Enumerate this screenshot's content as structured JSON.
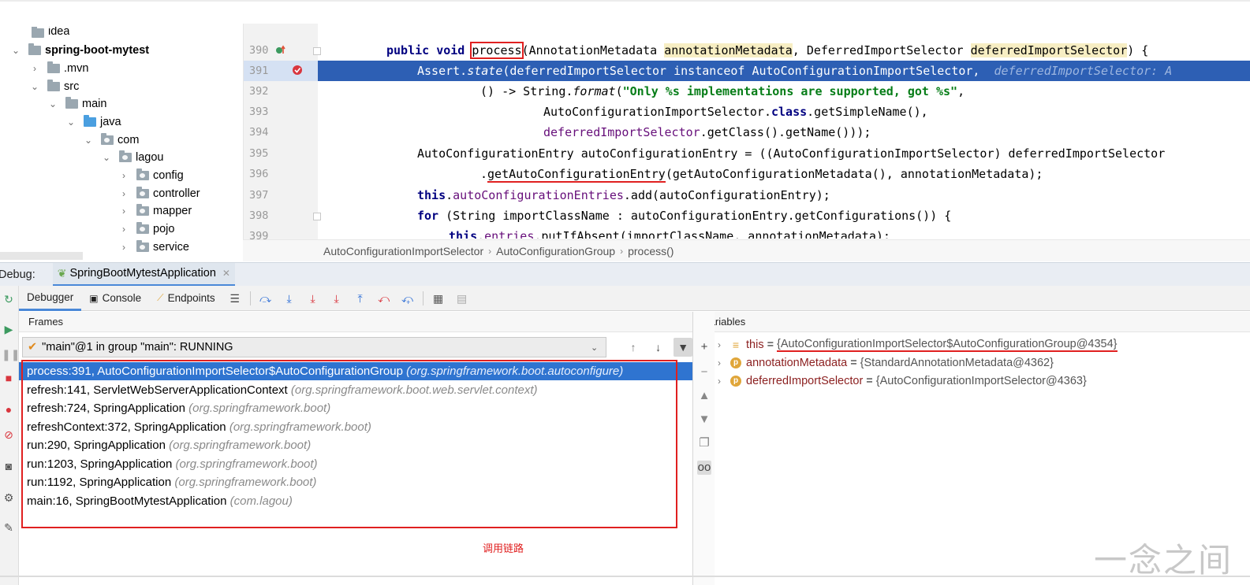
{
  "project_tree": {
    "items": [
      {
        "label": "idea",
        "depth": 1,
        "expanded": null,
        "icon": "folder-icon",
        "bold": false
      },
      {
        "label": "spring-boot-mytest",
        "depth": 0,
        "expanded": true,
        "icon": "module-folder-icon",
        "bold": true
      },
      {
        "label": ".mvn",
        "depth": 1,
        "expanded": false,
        "icon": "folder-icon",
        "bold": false
      },
      {
        "label": "src",
        "depth": 1,
        "expanded": true,
        "icon": "folder-icon",
        "bold": false
      },
      {
        "label": "main",
        "depth": 2,
        "expanded": true,
        "icon": "folder-icon",
        "bold": false
      },
      {
        "label": "java",
        "depth": 3,
        "expanded": true,
        "icon": "source-folder-icon",
        "bold": false
      },
      {
        "label": "com",
        "depth": 4,
        "expanded": true,
        "icon": "package-icon",
        "bold": false
      },
      {
        "label": "lagou",
        "depth": 5,
        "expanded": true,
        "icon": "package-icon",
        "bold": false
      },
      {
        "label": "config",
        "depth": 6,
        "expanded": false,
        "icon": "package-icon",
        "bold": false
      },
      {
        "label": "controller",
        "depth": 6,
        "expanded": false,
        "icon": "package-icon",
        "bold": false
      },
      {
        "label": "mapper",
        "depth": 6,
        "expanded": false,
        "icon": "package-icon",
        "bold": false
      },
      {
        "label": "pojo",
        "depth": 6,
        "expanded": false,
        "icon": "package-icon",
        "bold": false
      },
      {
        "label": "service",
        "depth": 6,
        "expanded": false,
        "icon": "package-icon",
        "bold": false
      }
    ]
  },
  "editor": {
    "line_numbers": [
      "390",
      "391",
      "392",
      "393",
      "394",
      "395",
      "396",
      "397",
      "398",
      "399"
    ],
    "current_line": "391",
    "code": {
      "l390_kw": "public void ",
      "l390_method": "process",
      "l390_a": "(AnnotationMetadata ",
      "l390_p1": "annotationMetadata",
      "l390_b": ", DeferredImportSelector ",
      "l390_p2": "deferredImportSelector",
      "l390_c": ") {",
      "l391_a": "Assert.",
      "l391_state": "state",
      "l391_b": "(deferredImportSelector instanceof AutoConfigurationImportSelector,",
      "l391_hint": "  deferredImportSelector: A",
      "l392_a": "() -> String.",
      "l392_format": "format",
      "l392_b": "(",
      "l392_str": "\"Only %s implementations are supported, got %s\"",
      "l392_c": ",",
      "l393_a": "AutoConfigurationImportSelector.",
      "l393_kw": "class",
      "l393_b": ".getSimpleName(),",
      "l394_fld": "deferredImportSelector",
      "l394_b": ".getClass().getName()));",
      "l395": "AutoConfigurationEntry autoConfigurationEntry = ((AutoConfigurationImportSelector) deferredImportSelector",
      "l396_a": ".",
      "l396_method": "getAutoConfigurationEntry",
      "l396_b": "(getAutoConfigurationMetadata(), annotationMetadata);",
      "l397_kw": "this",
      "l397_dot": ".",
      "l397_fld": "autoConfigurationEntries",
      "l397_b": ".add(autoConfigurationEntry);",
      "l398_kw": "for ",
      "l398_b": "(String importClassName : autoConfigurationEntry.getConfigurations()) {",
      "l399_kw": "this",
      "l399_dot": ".",
      "l399_fld": "entries",
      "l399_b": ".putIfAbsent(importClassName, annotationMetadata);"
    },
    "breadcrumb": [
      "AutoConfigurationImportSelector",
      "AutoConfigurationGroup",
      "process()"
    ]
  },
  "debug": {
    "label": "Debug:",
    "config_name": "SpringBootMytestApplication",
    "tabs": {
      "debugger": "Debugger",
      "console": "Console",
      "endpoints": "Endpoints"
    },
    "frames": {
      "header": "Frames",
      "thread": "\"main\"@1 in group \"main\": RUNNING",
      "list": [
        {
          "loc": "process:391, AutoConfigurationImportSelector$AutoConfigurationGroup",
          "pkg": "(org.springframework.boot.autoconfigure)",
          "selected": true
        },
        {
          "loc": "refresh:141, ServletWebServerApplicationContext",
          "pkg": "(org.springframework.boot.web.servlet.context)",
          "selected": false
        },
        {
          "loc": "refresh:724, SpringApplication",
          "pkg": "(org.springframework.boot)",
          "selected": false
        },
        {
          "loc": "refreshContext:372, SpringApplication",
          "pkg": "(org.springframework.boot)",
          "selected": false
        },
        {
          "loc": "run:290, SpringApplication",
          "pkg": "(org.springframework.boot)",
          "selected": false
        },
        {
          "loc": "run:1203, SpringApplication",
          "pkg": "(org.springframework.boot)",
          "selected": false
        },
        {
          "loc": "run:1192, SpringApplication",
          "pkg": "(org.springframework.boot)",
          "selected": false
        },
        {
          "loc": "main:16, SpringBootMytestApplication",
          "pkg": "(com.lagou)",
          "selected": false
        }
      ],
      "annotation": "调用链路"
    },
    "variables": {
      "header": "Variables",
      "list": [
        {
          "name": "this",
          "value": "{AutoConfigurationImportSelector$AutoConfigurationGroup@4354}",
          "icon": "field-list-icon"
        },
        {
          "name": "annotationMetadata",
          "value": "{StandardAnnotationMetadata@4362}",
          "icon": "parameter-icon"
        },
        {
          "name": "deferredImportSelector",
          "value": "{AutoConfigurationImportSelector@4363}",
          "icon": "parameter-icon"
        }
      ]
    }
  },
  "watermark": "一念之间",
  "colors": {
    "selection_blue": "#2f74d0",
    "exec_line_blue": "#2d5fb4",
    "annotation_red": "#e02020",
    "keyword_navy": "#000080",
    "string_green": "#067d17",
    "field_purple": "#660e7a"
  }
}
